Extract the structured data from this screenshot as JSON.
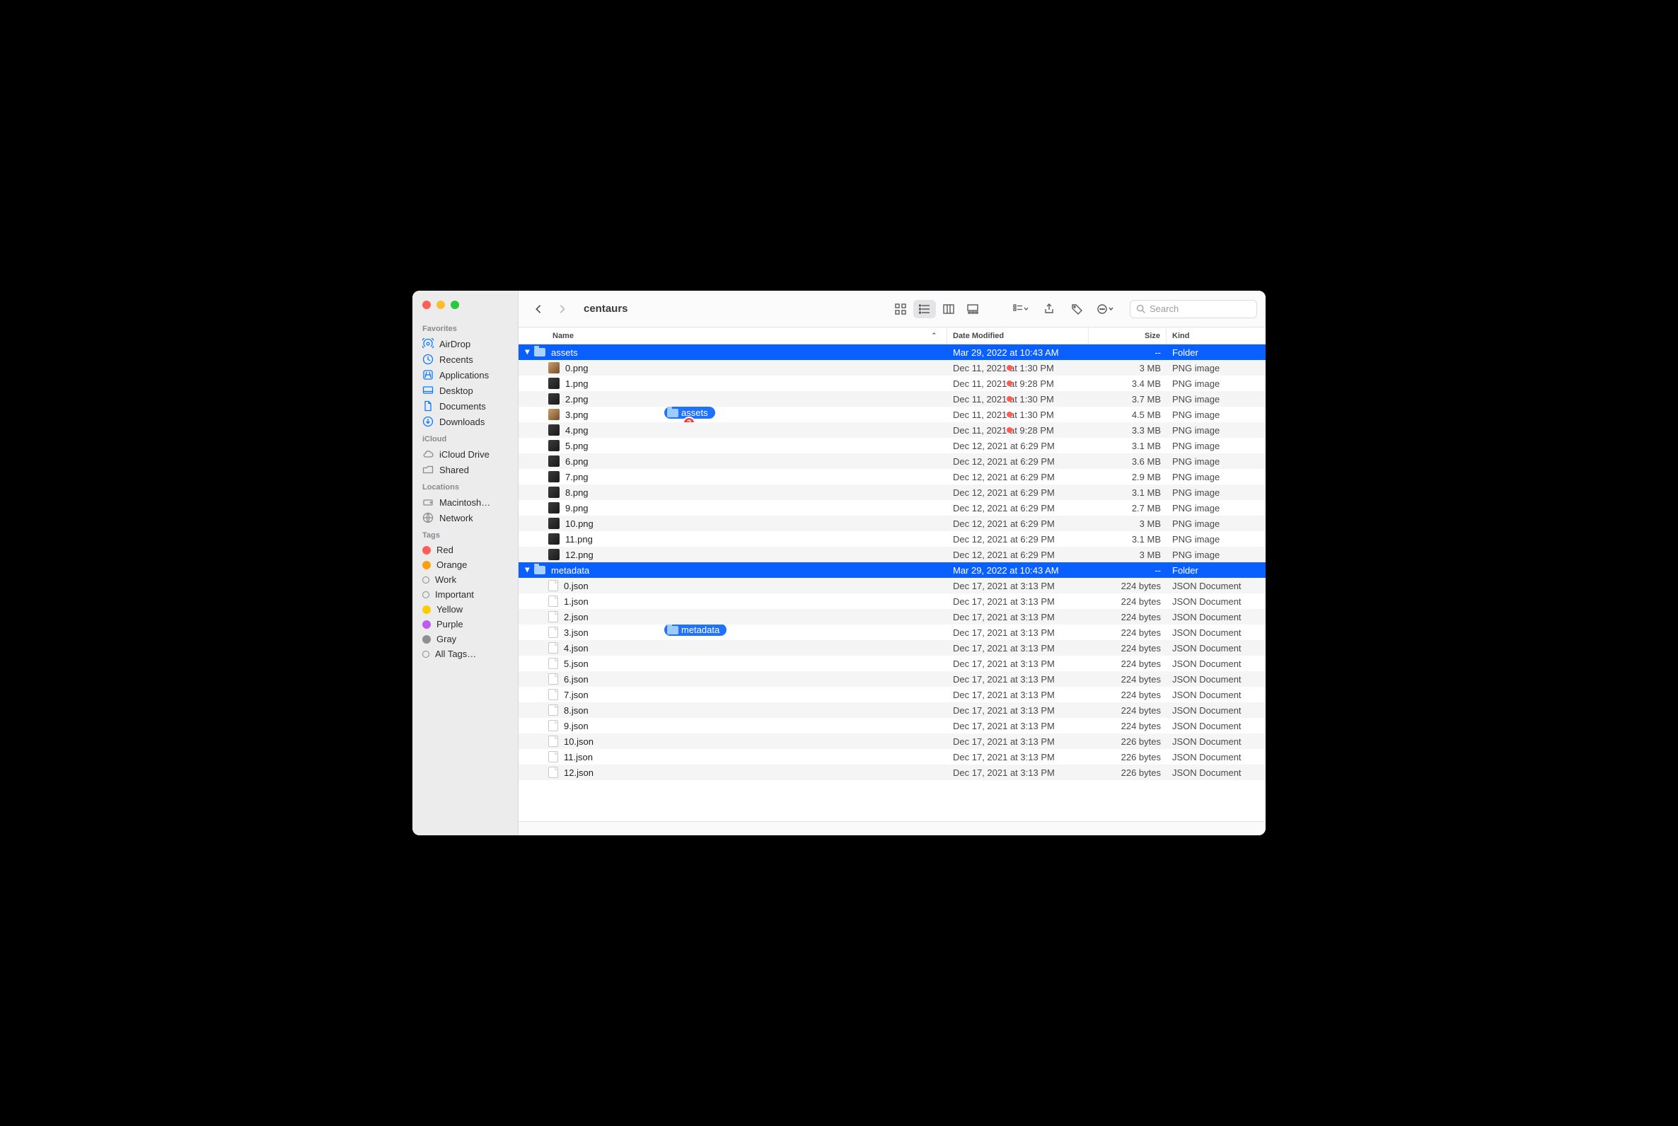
{
  "window_title": "centaurs",
  "search_placeholder": "Search",
  "sidebar": {
    "sections": [
      {
        "title": "Favorites",
        "items": [
          {
            "label": "AirDrop",
            "icon": "airdrop-icon",
            "icon_color": "blue"
          },
          {
            "label": "Recents",
            "icon": "clock-icon",
            "icon_color": "blue"
          },
          {
            "label": "Applications",
            "icon": "apps-icon",
            "icon_color": "blue"
          },
          {
            "label": "Desktop",
            "icon": "desktop-icon",
            "icon_color": "blue"
          },
          {
            "label": "Documents",
            "icon": "document-icon",
            "icon_color": "blue"
          },
          {
            "label": "Downloads",
            "icon": "download-icon",
            "icon_color": "blue"
          }
        ]
      },
      {
        "title": "iCloud",
        "items": [
          {
            "label": "iCloud Drive",
            "icon": "cloud-icon",
            "icon_color": "gray"
          },
          {
            "label": "Shared",
            "icon": "shared-icon",
            "icon_color": "gray"
          }
        ]
      },
      {
        "title": "Locations",
        "items": [
          {
            "label": "Macintosh…",
            "icon": "disk-icon",
            "icon_color": "gray"
          },
          {
            "label": "Network",
            "icon": "network-icon",
            "icon_color": "gray"
          }
        ]
      },
      {
        "title": "Tags",
        "items": [
          {
            "label": "Red",
            "tag_color": "#ff5d55"
          },
          {
            "label": "Orange",
            "tag_color": "#ff9f0a"
          },
          {
            "label": "Work",
            "tag_outline": true
          },
          {
            "label": "Important",
            "tag_outline": true
          },
          {
            "label": "Yellow",
            "tag_color": "#ffcc00"
          },
          {
            "label": "Purple",
            "tag_color": "#bf5af2"
          },
          {
            "label": "Gray",
            "tag_color": "#8e8e93"
          },
          {
            "label": "All Tags…",
            "tag_outline": true
          }
        ]
      }
    ]
  },
  "columns": {
    "name": "Name",
    "date": "Date Modified",
    "size": "Size",
    "kind": "Kind"
  },
  "drag": {
    "ghost1_label": "assets",
    "ghost2_label": "metadata",
    "badge_count": "2"
  },
  "rows": [
    {
      "name": "assets",
      "date": "Mar 29, 2022 at 10:43 AM",
      "size": "--",
      "kind": "Folder",
      "type": "folder",
      "depth": 0,
      "selected": true,
      "expanded": true
    },
    {
      "name": "0.png",
      "date": "Dec 11, 2021 at 1:30 PM",
      "size": "3 MB",
      "kind": "PNG image",
      "type": "png",
      "depth": 1,
      "tag_red": true,
      "png_variant": "light"
    },
    {
      "name": "1.png",
      "date": "Dec 11, 2021 at 9:28 PM",
      "size": "3.4 MB",
      "kind": "PNG image",
      "type": "png",
      "depth": 1,
      "tag_red": true,
      "png_variant": "dark"
    },
    {
      "name": "2.png",
      "date": "Dec 11, 2021 at 1:30 PM",
      "size": "3.7 MB",
      "kind": "PNG image",
      "type": "png",
      "depth": 1,
      "tag_red": true,
      "png_variant": "dark"
    },
    {
      "name": "3.png",
      "date": "Dec 11, 2021 at 1:30 PM",
      "size": "4.5 MB",
      "kind": "PNG image",
      "type": "png",
      "depth": 1,
      "tag_red": true,
      "png_variant": "light"
    },
    {
      "name": "4.png",
      "date": "Dec 11, 2021 at 9:28 PM",
      "size": "3.3 MB",
      "kind": "PNG image",
      "type": "png",
      "depth": 1,
      "tag_red": true,
      "png_variant": "dark"
    },
    {
      "name": "5.png",
      "date": "Dec 12, 2021 at 6:29 PM",
      "size": "3.1 MB",
      "kind": "PNG image",
      "type": "png",
      "depth": 1,
      "png_variant": "dark"
    },
    {
      "name": "6.png",
      "date": "Dec 12, 2021 at 6:29 PM",
      "size": "3.6 MB",
      "kind": "PNG image",
      "type": "png",
      "depth": 1,
      "png_variant": "dark"
    },
    {
      "name": "7.png",
      "date": "Dec 12, 2021 at 6:29 PM",
      "size": "2.9 MB",
      "kind": "PNG image",
      "type": "png",
      "depth": 1,
      "png_variant": "dark"
    },
    {
      "name": "8.png",
      "date": "Dec 12, 2021 at 6:29 PM",
      "size": "3.1 MB",
      "kind": "PNG image",
      "type": "png",
      "depth": 1,
      "png_variant": "dark"
    },
    {
      "name": "9.png",
      "date": "Dec 12, 2021 at 6:29 PM",
      "size": "2.7 MB",
      "kind": "PNG image",
      "type": "png",
      "depth": 1,
      "png_variant": "dark"
    },
    {
      "name": "10.png",
      "date": "Dec 12, 2021 at 6:29 PM",
      "size": "3 MB",
      "kind": "PNG image",
      "type": "png",
      "depth": 1,
      "png_variant": "dark"
    },
    {
      "name": "11.png",
      "date": "Dec 12, 2021 at 6:29 PM",
      "size": "3.1 MB",
      "kind": "PNG image",
      "type": "png",
      "depth": 1,
      "png_variant": "dark"
    },
    {
      "name": "12.png",
      "date": "Dec 12, 2021 at 6:29 PM",
      "size": "3 MB",
      "kind": "PNG image",
      "type": "png",
      "depth": 1,
      "png_variant": "dark"
    },
    {
      "name": "metadata",
      "date": "Mar 29, 2022 at 10:43 AM",
      "size": "--",
      "kind": "Folder",
      "type": "folder",
      "depth": 0,
      "selected": true,
      "expanded": true
    },
    {
      "name": "0.json",
      "date": "Dec 17, 2021 at 3:13 PM",
      "size": "224 bytes",
      "kind": "JSON Document",
      "type": "json",
      "depth": 1
    },
    {
      "name": "1.json",
      "date": "Dec 17, 2021 at 3:13 PM",
      "size": "224 bytes",
      "kind": "JSON Document",
      "type": "json",
      "depth": 1
    },
    {
      "name": "2.json",
      "date": "Dec 17, 2021 at 3:13 PM",
      "size": "224 bytes",
      "kind": "JSON Document",
      "type": "json",
      "depth": 1
    },
    {
      "name": "3.json",
      "date": "Dec 17, 2021 at 3:13 PM",
      "size": "224 bytes",
      "kind": "JSON Document",
      "type": "json",
      "depth": 1
    },
    {
      "name": "4.json",
      "date": "Dec 17, 2021 at 3:13 PM",
      "size": "224 bytes",
      "kind": "JSON Document",
      "type": "json",
      "depth": 1
    },
    {
      "name": "5.json",
      "date": "Dec 17, 2021 at 3:13 PM",
      "size": "224 bytes",
      "kind": "JSON Document",
      "type": "json",
      "depth": 1
    },
    {
      "name": "6.json",
      "date": "Dec 17, 2021 at 3:13 PM",
      "size": "224 bytes",
      "kind": "JSON Document",
      "type": "json",
      "depth": 1
    },
    {
      "name": "7.json",
      "date": "Dec 17, 2021 at 3:13 PM",
      "size": "224 bytes",
      "kind": "JSON Document",
      "type": "json",
      "depth": 1
    },
    {
      "name": "8.json",
      "date": "Dec 17, 2021 at 3:13 PM",
      "size": "224 bytes",
      "kind": "JSON Document",
      "type": "json",
      "depth": 1
    },
    {
      "name": "9.json",
      "date": "Dec 17, 2021 at 3:13 PM",
      "size": "224 bytes",
      "kind": "JSON Document",
      "type": "json",
      "depth": 1
    },
    {
      "name": "10.json",
      "date": "Dec 17, 2021 at 3:13 PM",
      "size": "226 bytes",
      "kind": "JSON Document",
      "type": "json",
      "depth": 1
    },
    {
      "name": "11.json",
      "date": "Dec 17, 2021 at 3:13 PM",
      "size": "226 bytes",
      "kind": "JSON Document",
      "type": "json",
      "depth": 1
    },
    {
      "name": "12.json",
      "date": "Dec 17, 2021 at 3:13 PM",
      "size": "226 bytes",
      "kind": "JSON Document",
      "type": "json",
      "depth": 1
    }
  ]
}
